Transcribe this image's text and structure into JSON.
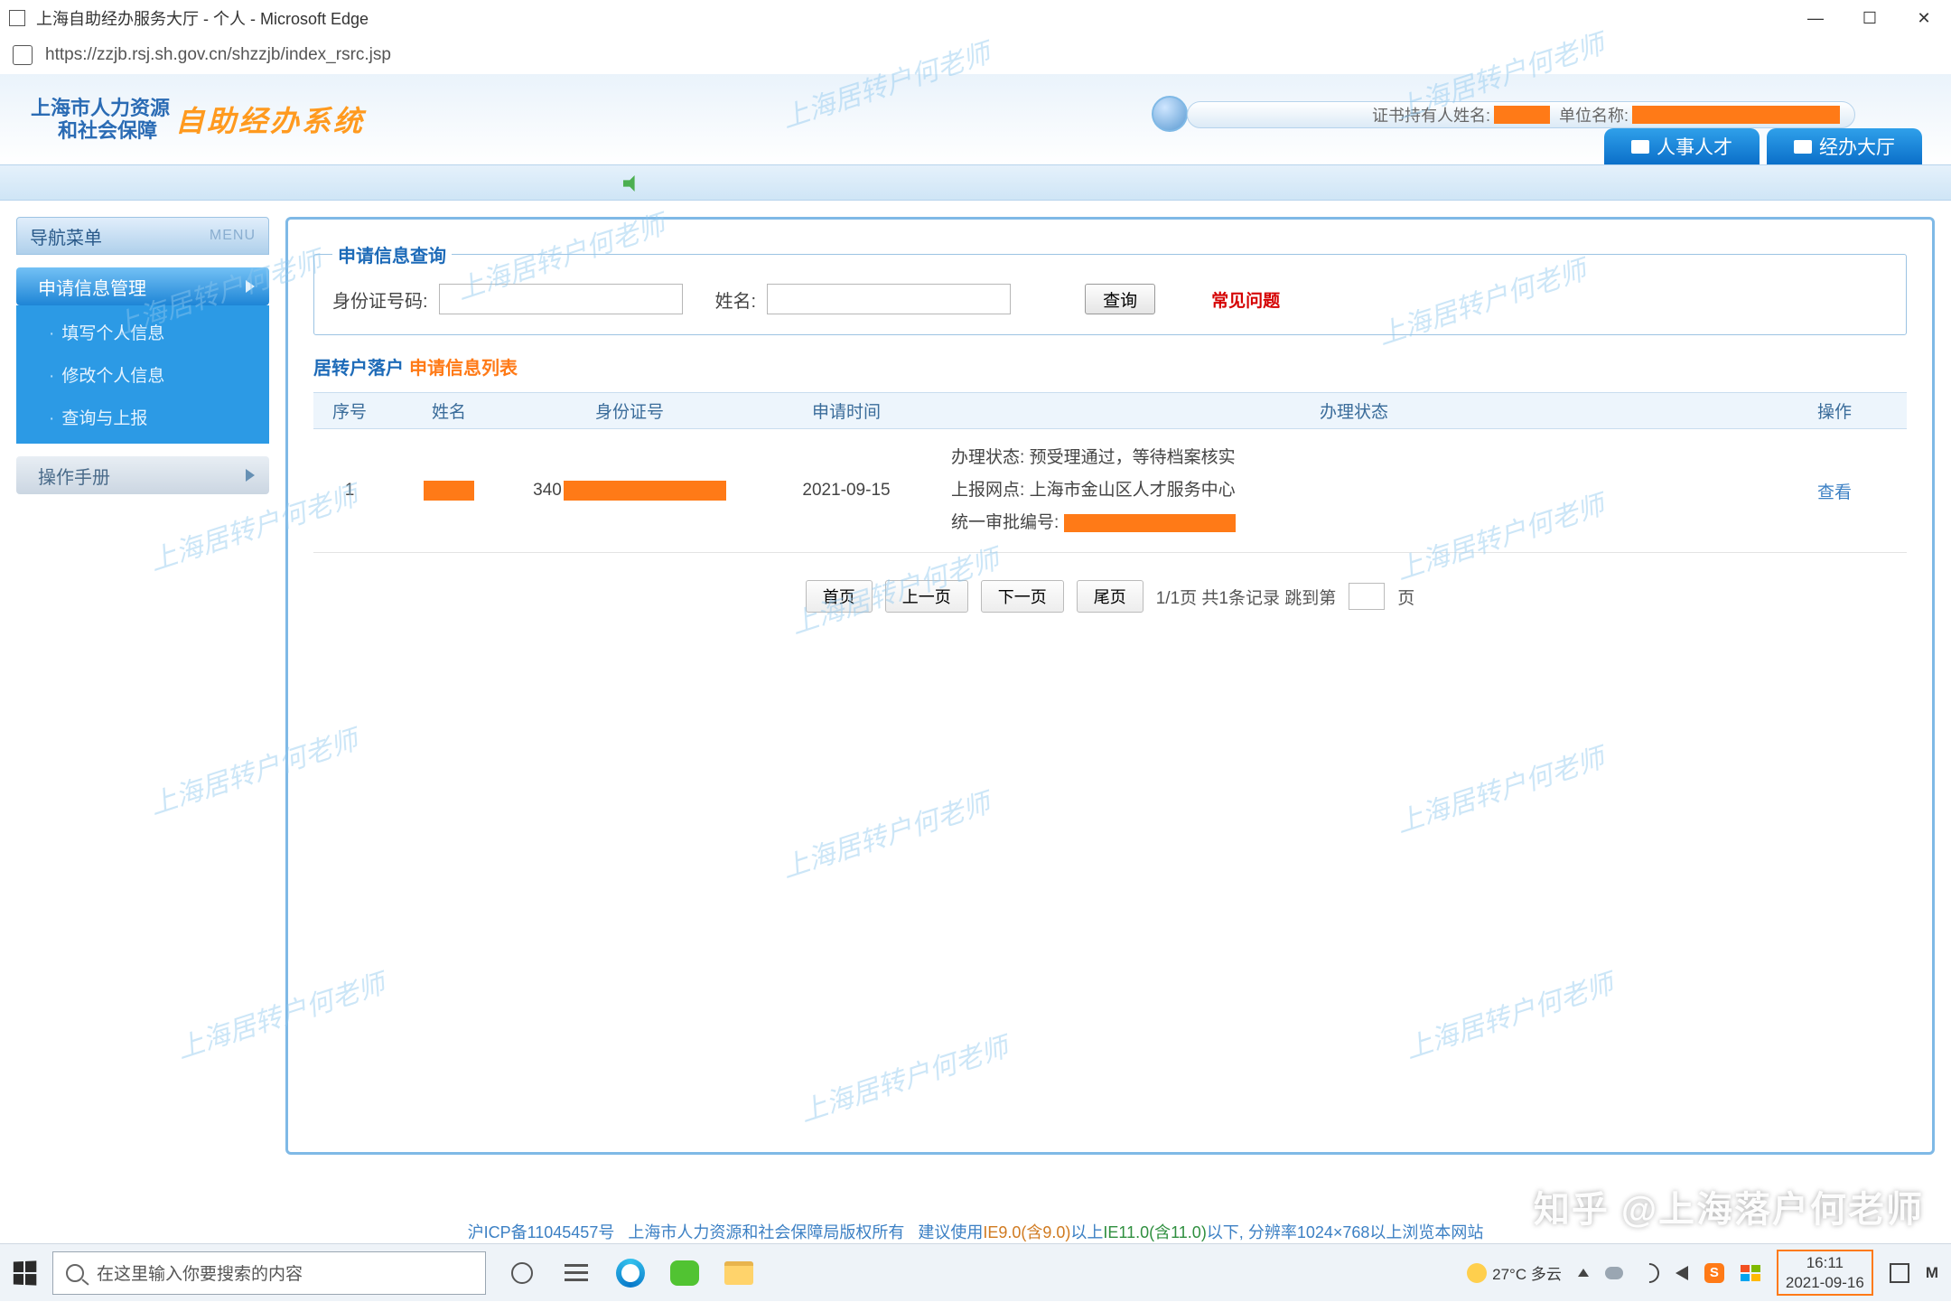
{
  "window": {
    "title": "上海自助经办服务大厅 - 个人 - Microsoft Edge",
    "url": "https://zzjb.rsj.sh.gov.cn/shzzjb/index_rsrc.jsp"
  },
  "watermark_text": "上海居转户何老师",
  "banner": {
    "line1": "上海市人力资源",
    "line2": "和社会保障",
    "system": "自助经办系统",
    "cert_holder_label": "证书持有人姓名:",
    "unit_label": "单位名称:",
    "tabs": [
      {
        "label": "人事人才"
      },
      {
        "label": "经办大厅"
      }
    ]
  },
  "sidebar": {
    "title": "导航菜单",
    "menu_label": "MENU",
    "groups": [
      {
        "label": "申请信息管理",
        "expanded": true,
        "items": [
          {
            "label": "填写个人信息"
          },
          {
            "label": "修改个人信息"
          },
          {
            "label": "查询与上报"
          }
        ]
      },
      {
        "label": "操作手册",
        "expanded": false
      }
    ]
  },
  "query": {
    "legend": "申请信息查询",
    "id_label": "身份证号码:",
    "name_label": "姓名:",
    "id_value": "",
    "name_value": "",
    "button": "查询",
    "faq": "常见问题"
  },
  "list": {
    "title_prefix": "居转户落户",
    "title_main": "申请信息列表",
    "columns": [
      "序号",
      "姓名",
      "身份证号",
      "申请时间",
      "办理状态",
      "操作"
    ],
    "rows": [
      {
        "index": "1",
        "name": "",
        "id_prefix": "340",
        "apply_date": "2021-09-15",
        "status_label": "办理状态:",
        "status_value": "预受理通过，等待档案核实",
        "upload_label": "上报网点:",
        "upload_value": "上海市金山区人才服务中心",
        "approval_label": "统一审批编号:",
        "action": "查看"
      }
    ]
  },
  "pager": {
    "first": "首页",
    "prev": "上一页",
    "next": "下一页",
    "last": "尾页",
    "info": "1/1页 共1条记录 跳到第",
    "page_suffix": "页",
    "page_input": ""
  },
  "footer": {
    "icp": "沪ICP备11045457号",
    "copyright": "上海市人力资源和社会保障局版权所有",
    "suggest": "建议使用",
    "ie9": "IE9.0(含9.0)",
    "mid": "以上",
    "ie11": "IE11.0(含11.0)",
    "rest": "以下, 分辨率1024×768以上浏览本网站"
  },
  "zhihu_watermark": "知乎 @上海落户何老师",
  "taskbar": {
    "search_placeholder": "在这里输入你要搜索的内容",
    "weather": "27°C 多云",
    "time": "16:11",
    "date": "2021-09-16",
    "ime": "M"
  }
}
